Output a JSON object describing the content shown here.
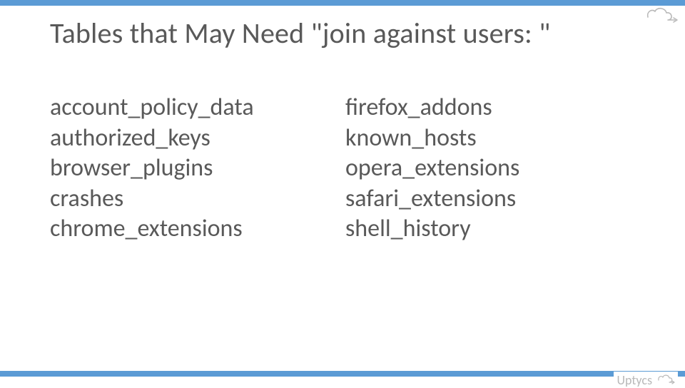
{
  "title": "Tables that May Need \"join against users: \"",
  "columns": {
    "left": [
      "account_policy_data",
      "authorized_keys",
      "browser_plugins",
      "crashes",
      "chrome_extensions"
    ],
    "right": [
      "firefox_addons",
      "known_hosts",
      "opera_extensions",
      "safari_extensions",
      "shell_history"
    ]
  },
  "brand": "Uptycs",
  "colors": {
    "accent": "#5b9bd5",
    "text": "#595959",
    "brand_text": "#b9b9b9"
  }
}
